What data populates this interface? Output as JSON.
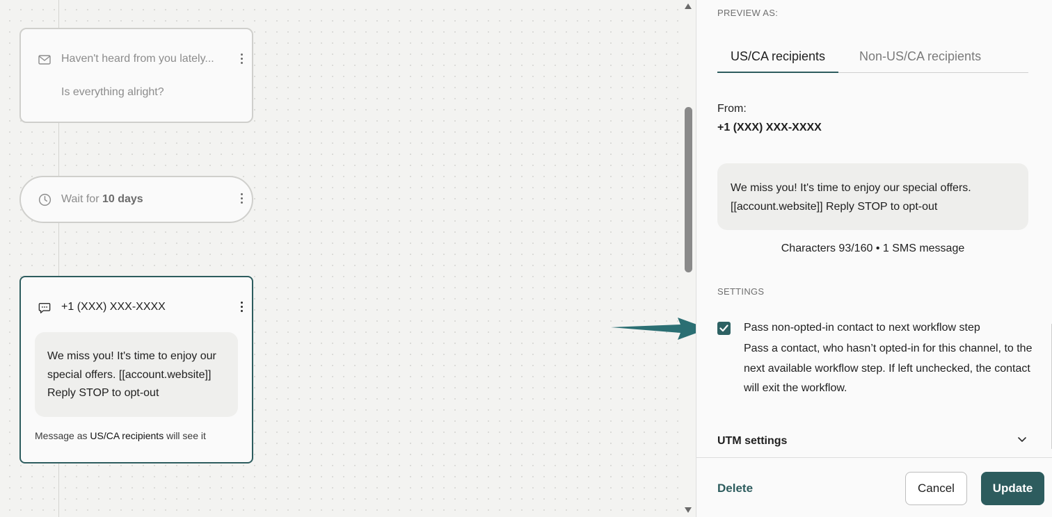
{
  "canvas": {
    "email_node": {
      "icon": "envelope-icon",
      "title": "Haven't heard from you lately...",
      "subtitle": "Is everything alright?"
    },
    "wait_node": {
      "icon": "clock-icon",
      "prefix": "Wait for ",
      "duration": "10 days"
    },
    "sms_node": {
      "icon": "chat-bubble-icon",
      "title": "+1 (XXX) XXX-XXXX",
      "message": "We miss you! It's time to enjoy our special offers. [[account.website]] Reply STOP to opt-out",
      "note_prefix": "Message as ",
      "note_bold": "US/CA recipients",
      "note_suffix": " will see it"
    }
  },
  "panel": {
    "preview_label": "PREVIEW AS:",
    "tabs": [
      {
        "label": "US/CA recipients",
        "active": true
      },
      {
        "label": "Non-US/CA recipients",
        "active": false
      }
    ],
    "from_label": "From:",
    "from_number": "+1 (XXX) XXX-XXXX",
    "preview_message": "We miss you! It's time to enjoy our special offers. [[account.website]] Reply STOP to opt-out",
    "char_count": "Characters 93/160 • 1 SMS message",
    "settings_label": "SETTINGS",
    "checkbox": {
      "checked": true,
      "title": "Pass non-opted-in contact to next workflow step",
      "description": "Pass a contact, who hasn’t opted-in for this channel, to the next available workflow step. If left unchecked, the contact will exit the workflow."
    },
    "utm_label": "UTM settings",
    "footer": {
      "delete_label": "Delete",
      "cancel_label": "Cancel",
      "update_label": "Update"
    }
  },
  "colors": {
    "accent": "#2d5c5e",
    "arrow": "#2b6f73",
    "canvas_bg": "#f3f3f1"
  }
}
